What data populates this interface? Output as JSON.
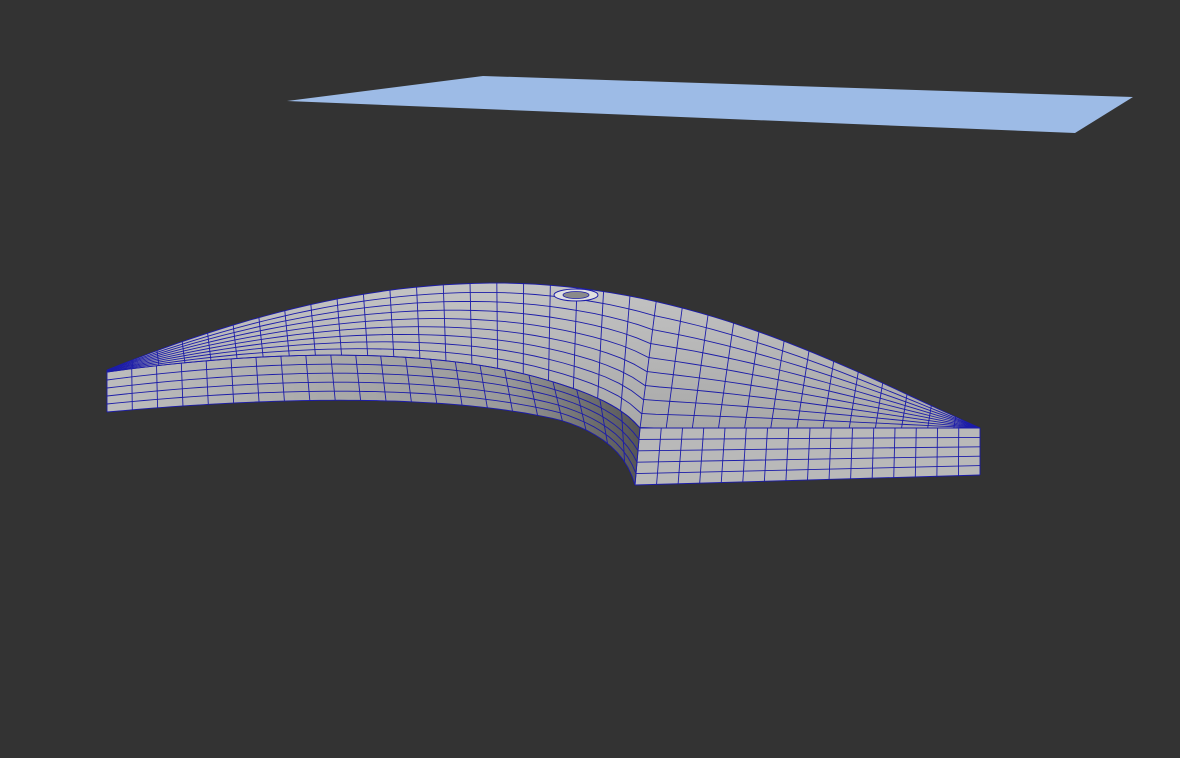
{
  "viewport": {
    "background_color": "#333333",
    "plane_color": "#9dbbe6",
    "mesh_color": "#b4b4b4",
    "wire_color": "#1c1ca8"
  },
  "mesh": {
    "top_rows": 9,
    "top_cols": 34,
    "side_rows": 5,
    "left_side_cols": 22,
    "right_side_cols": 16
  }
}
